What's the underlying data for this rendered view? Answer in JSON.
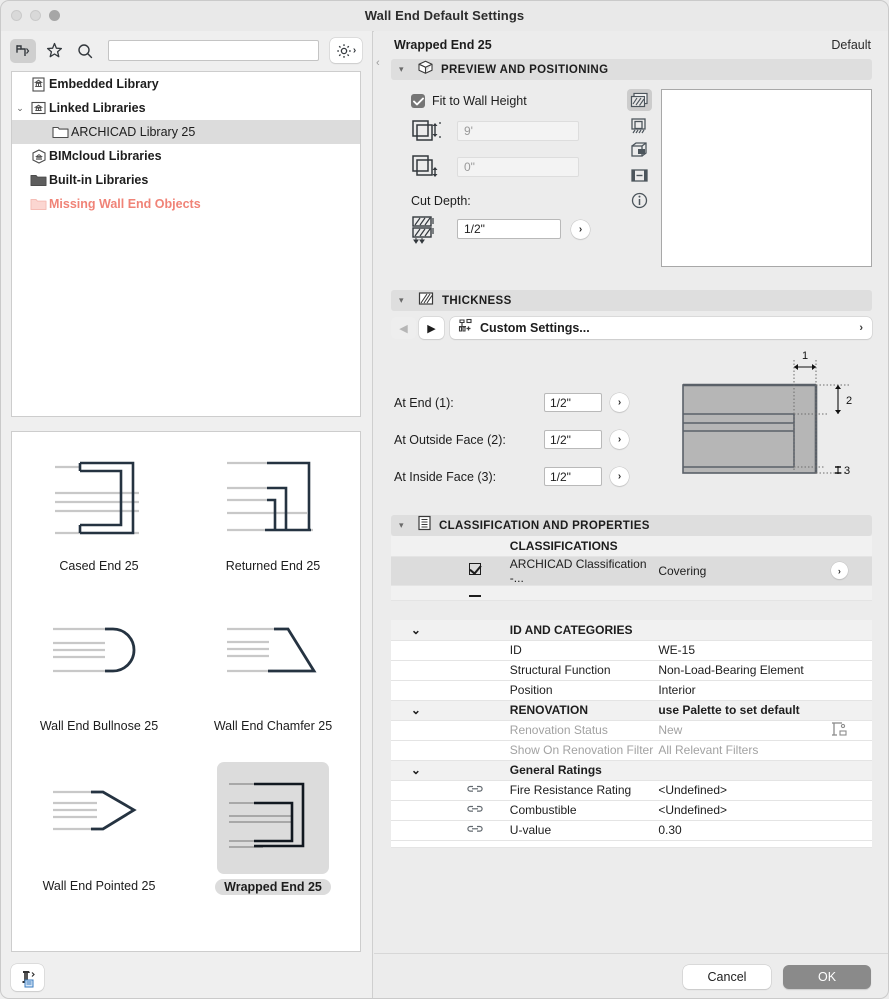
{
  "window": {
    "title": "Wall End Default Settings"
  },
  "library_toolbar": {
    "object_tool_icon": "wall-end-object-icon",
    "favorites_icon": "star-icon",
    "search_icon": "search-icon",
    "search_value": "",
    "search_placeholder": "",
    "settings_icon": "gear-icon"
  },
  "library_tree": {
    "items": [
      {
        "label": "Embedded Library",
        "icon": "embedded-library-icon",
        "indent": 1,
        "twisty": "",
        "selected": false,
        "bold": true,
        "missing": false
      },
      {
        "label": "Linked Libraries",
        "icon": "linked-library-icon",
        "indent": 0,
        "twisty": "⌄",
        "selected": false,
        "bold": true,
        "missing": false
      },
      {
        "label": "ARCHICAD Library 25",
        "icon": "folder-outline-icon",
        "indent": 2,
        "twisty": "",
        "selected": true,
        "bold": false,
        "missing": false
      },
      {
        "label": "BIMcloud Libraries",
        "icon": "bimcloud-icon",
        "indent": 1,
        "twisty": "",
        "selected": false,
        "bold": true,
        "missing": false
      },
      {
        "label": "Built-in Libraries",
        "icon": "folder-filled-icon",
        "indent": 1,
        "twisty": "",
        "selected": false,
        "bold": true,
        "missing": false
      },
      {
        "label": "Missing Wall End Objects",
        "icon": "missing-folder-icon",
        "indent": 1,
        "twisty": "",
        "selected": false,
        "bold": true,
        "missing": true
      }
    ]
  },
  "gallery": {
    "items": [
      {
        "label": "Cased End 25",
        "shape": "cased",
        "selected": false
      },
      {
        "label": "Returned End 25",
        "shape": "returned",
        "selected": false
      },
      {
        "label": "Wall End Bullnose 25",
        "shape": "bullnose",
        "selected": false
      },
      {
        "label": "Wall End Chamfer 25",
        "shape": "chamfer",
        "selected": false
      },
      {
        "label": "Wall End Pointed 25",
        "shape": "pointed",
        "selected": false
      },
      {
        "label": "Wrapped End 25",
        "shape": "wrapped",
        "selected": true
      }
    ]
  },
  "left_footer": {
    "embed_icon": "embed-object-icon"
  },
  "right_header": {
    "title": "Wrapped End 25",
    "default_label": "Default"
  },
  "preview_positioning": {
    "section_title": "PREVIEW AND POSITIONING",
    "section_icon": "cube-icon",
    "fit_to_wall_height_label": "Fit to Wall Height",
    "fit_to_wall_height_checked": true,
    "height_value": "9'",
    "offset_value": "0\"",
    "cut_depth_label": "Cut Depth:",
    "cut_depth_value": "1/2\"",
    "view_icons": [
      {
        "name": "2d-symbol-icon",
        "active": true
      },
      {
        "name": "elevation-view-icon",
        "active": false
      },
      {
        "name": "3d-view-icon",
        "active": false
      },
      {
        "name": "section-view-icon",
        "active": false
      },
      {
        "name": "info-icon",
        "active": false
      }
    ]
  },
  "thickness": {
    "section_title": "THICKNESS",
    "section_icon": "hatch-icon",
    "prev_label": "◀",
    "next_label": "▶",
    "combo_label": "Custom Settings...",
    "combo_icon": "favorites-settings-icon",
    "combo_chevron": "›",
    "rows": [
      {
        "label": "At End (1):",
        "value": "1/2\""
      },
      {
        "label": "At Outside Face (2):",
        "value": "1/2\""
      },
      {
        "label": "At Inside Face (3):",
        "value": "1/2\""
      }
    ],
    "diagram_markers": [
      "1",
      "2",
      "3"
    ]
  },
  "classification": {
    "section_title": "CLASSIFICATION AND PROPERTIES",
    "section_icon": "list-document-icon",
    "groups": [
      {
        "title": "CLASSIFICATIONS",
        "twisty": "",
        "value": "",
        "rows": [
          {
            "checkbox": true,
            "name": "ARCHICAD Classification -...",
            "value": "Covering",
            "selected": true,
            "action": "›",
            "icon": "",
            "gray": false
          }
        ]
      },
      {
        "title": "ID AND CATEGORIES",
        "twisty": "⌄",
        "value": "",
        "rows": [
          {
            "checkbox": false,
            "name": "ID",
            "value": "WE-15",
            "selected": false,
            "action": "",
            "icon": "",
            "gray": false
          },
          {
            "checkbox": false,
            "name": "Structural Function",
            "value": "Non-Load-Bearing Element",
            "selected": false,
            "action": "",
            "icon": "",
            "gray": false
          },
          {
            "checkbox": false,
            "name": "Position",
            "value": "Interior",
            "selected": false,
            "action": "",
            "icon": "",
            "gray": false
          }
        ]
      },
      {
        "title": "RENOVATION",
        "twisty": "⌄",
        "value": "use Palette to set default",
        "rows": [
          {
            "checkbox": false,
            "name": "Renovation Status",
            "value": "New",
            "selected": false,
            "action": "renovation-icon",
            "icon": "",
            "gray": true
          },
          {
            "checkbox": false,
            "name": "Show On Renovation Filter",
            "value": "All Relevant Filters",
            "selected": false,
            "action": "",
            "icon": "",
            "gray": true
          }
        ]
      },
      {
        "title": "General Ratings",
        "twisty": "⌄",
        "value": "",
        "rows": [
          {
            "checkbox": false,
            "name": "Fire Resistance Rating",
            "value": "<Undefined>",
            "selected": false,
            "action": "",
            "icon": "link-icon",
            "gray": false
          },
          {
            "checkbox": false,
            "name": "Combustible",
            "value": "<Undefined>",
            "selected": false,
            "action": "",
            "icon": "link-icon",
            "gray": false
          },
          {
            "checkbox": false,
            "name": "U-value",
            "value": "0.30",
            "selected": false,
            "action": "",
            "icon": "link-icon",
            "gray": false
          }
        ]
      }
    ]
  },
  "footer": {
    "cancel_label": "Cancel",
    "ok_label": "OK"
  },
  "colors": {
    "accent_missing": "#f08377",
    "selection": "#dcdcdc",
    "ok_button": "#8a8a8a",
    "section_header": "#dedede"
  }
}
